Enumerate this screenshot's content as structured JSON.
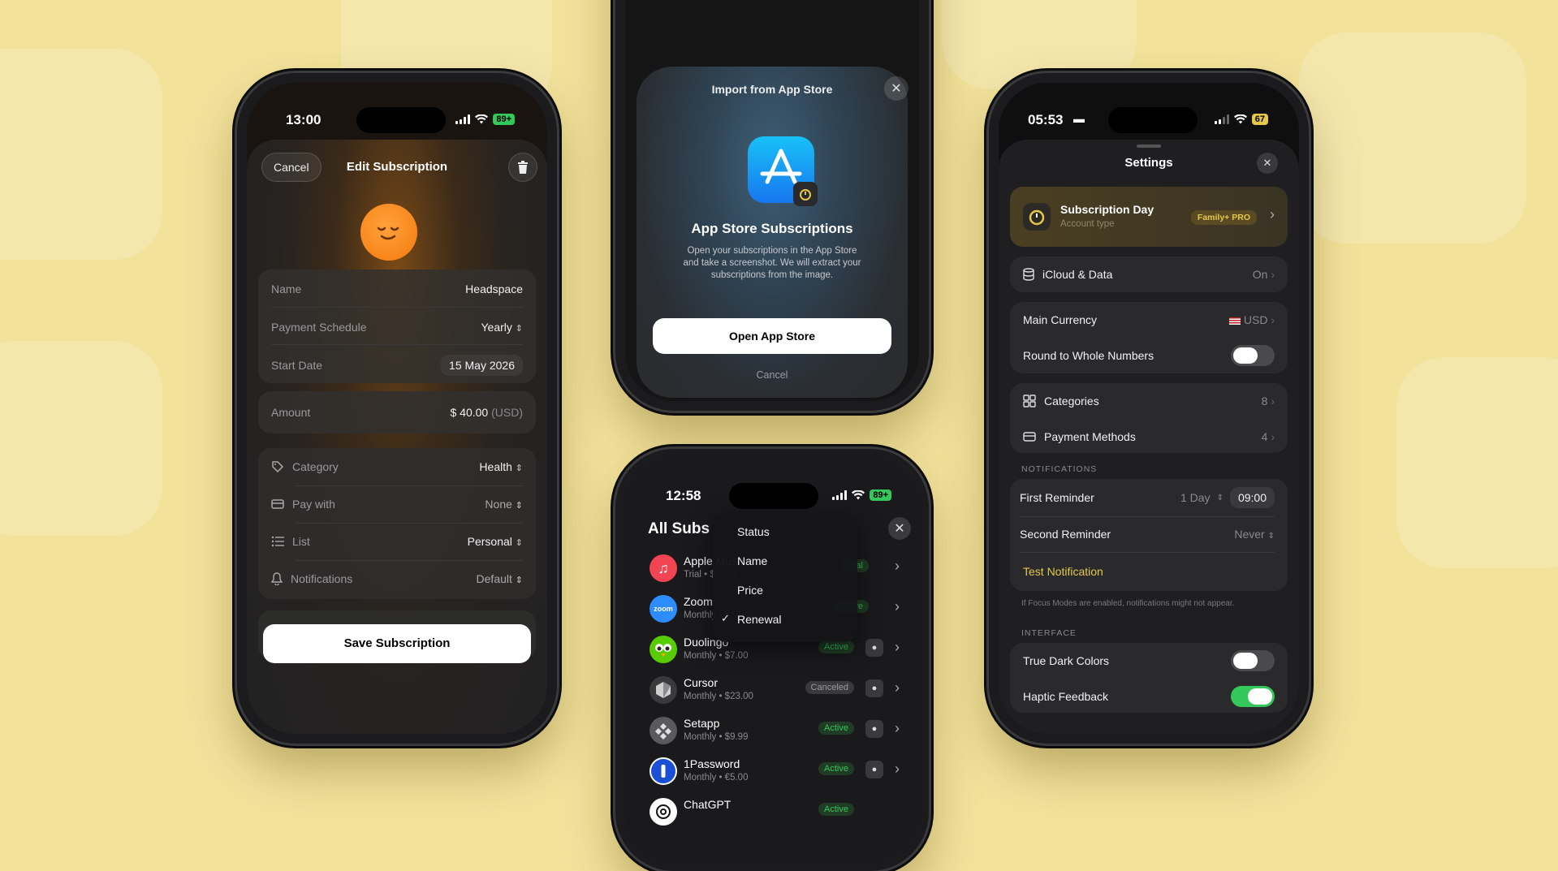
{
  "phone1": {
    "time": "13:00",
    "battery": "89+",
    "cancel": "Cancel",
    "title": "Edit Subscription",
    "fields": [
      {
        "label": "Name",
        "value": "Headspace"
      },
      {
        "label": "Payment Schedule",
        "value": "Yearly"
      },
      {
        "label": "Start Date",
        "value": "15 May 2026"
      }
    ],
    "amount_label": "Amount",
    "amount_value": "$ 40.00",
    "amount_currency": "(USD)",
    "details": [
      {
        "label": "Category",
        "value": "Health",
        "icon": "tag-icon"
      },
      {
        "label": "Pay with",
        "value": "None",
        "icon": "card-icon"
      },
      {
        "label": "List",
        "value": "Personal",
        "icon": "list-icon"
      },
      {
        "label": "Notifications",
        "value": "Default",
        "icon": "bell-icon"
      }
    ],
    "save": "Save Subscription"
  },
  "phone2": {
    "title": "Import from App Store",
    "heading": "App Store Subscriptions",
    "body": "Open your subscriptions in the App Store and take a screenshot. We will extract your subscriptions from the image.",
    "open_button": "Open App Store",
    "cancel": "Cancel"
  },
  "phone3": {
    "time": "12:58",
    "battery": "89+",
    "title": "All Subs",
    "menu": [
      "Status",
      "Name",
      "Price",
      "Renewal"
    ],
    "menu_checked": "Renewal",
    "subs": [
      {
        "name": "Apple Music",
        "sub": "Trial • $10.99",
        "status": "Trial",
        "icon_color": "#f24452"
      },
      {
        "name": "Zoom",
        "sub": "Monthly • $13.33",
        "status": "Active",
        "icon_color": "#2d8cff"
      },
      {
        "name": "Duolingo",
        "sub": "Monthly • $7.00",
        "status": "Active",
        "icon_color": "#58cc02"
      },
      {
        "name": "Cursor",
        "sub": "Monthly • $23.00",
        "status": "Canceled",
        "icon_color": "#3a3a3c"
      },
      {
        "name": "Setapp",
        "sub": "Monthly • $9.99",
        "status": "Active",
        "icon_color": "#5a5a5e"
      },
      {
        "name": "1Password",
        "sub": "Monthly • €5.00",
        "status": "Active",
        "icon_color": "#1a4fd6"
      },
      {
        "name": "ChatGPT",
        "sub": "",
        "status": "Active",
        "icon_color": "#ffffff"
      }
    ]
  },
  "phone4": {
    "time": "05:53",
    "battery": "67",
    "title": "Settings",
    "account_name": "Subscription Day",
    "account_type": "Account type",
    "account_badge": "Family+ PRO",
    "icloud_label": "iCloud & Data",
    "icloud_value": "On",
    "currency_label": "Main Currency",
    "currency_value": "USD",
    "round_label": "Round to Whole Numbers",
    "categories_label": "Categories",
    "categories_count": "8",
    "payment_label": "Payment Methods",
    "payment_count": "4",
    "notifications_header": "NOTIFICATIONS",
    "first_reminder": "First Reminder",
    "first_reminder_day": "1 Day",
    "first_reminder_time": "09:00",
    "second_reminder": "Second Reminder",
    "second_reminder_value": "Never",
    "test_notification": "Test Notification",
    "focus_note": "If Focus Modes are enabled, notifications might not appear.",
    "interface_header": "INTERFACE",
    "true_dark": "True Dark Colors",
    "haptic": "Haptic Feedback"
  },
  "colors": {
    "accent_yellow": "#e5c84a",
    "green": "#34c759",
    "background": "#f2e29a"
  }
}
